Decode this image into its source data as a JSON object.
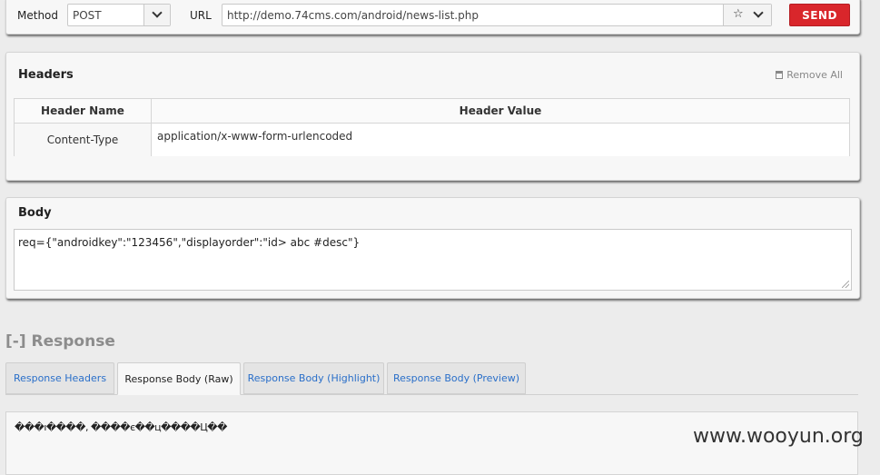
{
  "request": {
    "method_label": "Method",
    "method_value": "POST",
    "url_label": "URL",
    "url_value": "http://demo.74cms.com/android/news-list.php",
    "send_label": "SEND"
  },
  "headers": {
    "title": "Headers",
    "remove_all": "Remove All",
    "col_name": "Header Name",
    "col_value": "Header Value",
    "rows": [
      {
        "name": "Content-Type",
        "value": "application/x-www-form-urlencoded"
      }
    ]
  },
  "body": {
    "title": "Body",
    "value": "req={\"androidkey\":\"123456\",\"displayorder\":\"id> abc #desc\"}"
  },
  "response": {
    "title": "[-] Response",
    "tabs": [
      {
        "label": "Response Headers",
        "active": false
      },
      {
        "label": "Response Body (Raw)",
        "active": true
      },
      {
        "label": "Response Body (Highlight)",
        "active": false
      },
      {
        "label": "Response Body (Preview)",
        "active": false
      }
    ],
    "raw_body": "���ו����, ����є��ц����Ц��"
  },
  "watermark": "www.wooyun.org",
  "colors": {
    "send": "#d9262b",
    "tab_link": "#2a6fc9",
    "response_title": "#8c8c8c"
  }
}
